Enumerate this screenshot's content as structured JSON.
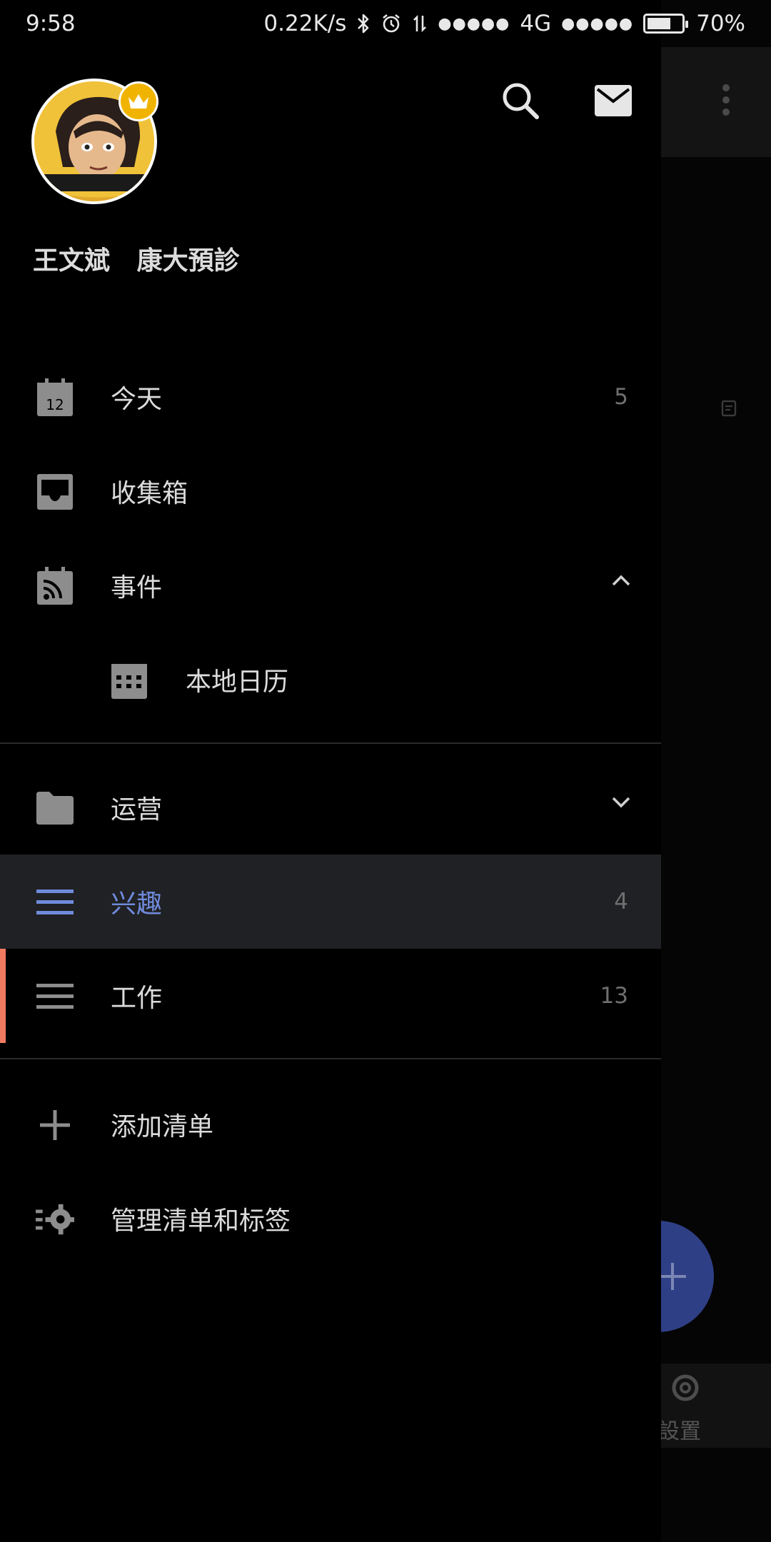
{
  "status_bar": {
    "time": "9:58",
    "net_speed": "0.22K/s",
    "signal_dots_1": "●●●●●",
    "network": "4G",
    "signal_dots_2": "●●●●●",
    "battery_level": 0.7,
    "battery_text": "70%"
  },
  "drawer": {
    "header": {
      "avatar_icon": "user-avatar",
      "badge_icon": "crown-icon",
      "search_icon": "search-icon",
      "mail_icon": "mail-icon",
      "user_name": "王文斌   康大預診"
    },
    "items": [
      {
        "label": "今天",
        "count": "5",
        "icon": "calendar-today-icon",
        "icon_text": "12"
      },
      {
        "label": "收集箱",
        "icon": "inbox-icon"
      },
      {
        "label": "事件",
        "icon": "calendar-feed-icon",
        "expand": "chevron-up-icon"
      },
      {
        "label": "本地日历",
        "icon": "calendar-grid-icon"
      }
    ],
    "lists": [
      {
        "label": "运营",
        "icon": "folder-icon",
        "expand": "chevron-down-icon"
      },
      {
        "label": "兴趣",
        "count": "4",
        "icon": "list-icon",
        "selected": true
      },
      {
        "label": "工作",
        "count": "13",
        "icon": "list-icon",
        "stripe_color": "#f07a60"
      }
    ],
    "actions": [
      {
        "label": "添加清单",
        "icon": "plus-icon"
      },
      {
        "label": "管理清单和标签",
        "icon": "settings-list-icon"
      }
    ]
  },
  "background_app": {
    "bottom_label": "設置",
    "fab_icon": "plus-icon",
    "more_icon": "more-vert-icon"
  },
  "colors": {
    "accent": "#6f8bdc",
    "selected_bg": "#202124",
    "fab": "#2f3f86",
    "stripe": "#f07a60"
  }
}
